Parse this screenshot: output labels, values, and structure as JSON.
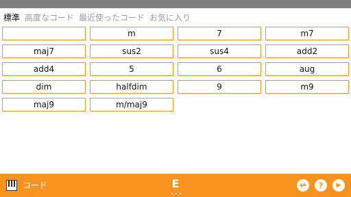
{
  "tabs": [
    "標準",
    "高度なコード",
    "最近使ったコード",
    "お気に入り"
  ],
  "chords": [
    "",
    "m",
    "7",
    "m7",
    "maj7",
    "sus2",
    "sus4",
    "add2",
    "add4",
    "5",
    "6",
    "aug",
    "dim",
    "halfdim",
    "9",
    "m9",
    "maj9",
    "m/maj9"
  ],
  "bottom": {
    "label": "コード",
    "key": "E",
    "help_glyph": "?",
    "play_glyph": "▶"
  },
  "colors": {
    "accent": "#f7931e",
    "status_bar": "#7f7f7f",
    "active_tab": "#111111",
    "inactive_tab": "#9a9a9a"
  },
  "icons": [
    "piano-icon",
    "settings-slider-icon",
    "help-icon",
    "play-icon"
  ]
}
